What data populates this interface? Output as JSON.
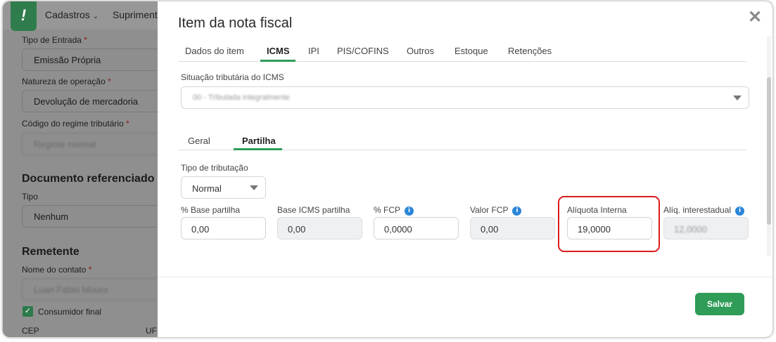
{
  "app": {
    "nav": [
      "Cadastros",
      "Suprimentos"
    ],
    "form": {
      "tipo_entrada_label": "Tipo de Entrada",
      "tipo_entrada_value": "Emissão Própria",
      "natureza_label": "Natureza de operação",
      "natureza_value": "Devolução de mercadoria",
      "regime_label": "Código do regime tributário",
      "regime_value": "Regime normal",
      "doc_ref_heading": "Documento referenciado",
      "tipo_label": "Tipo",
      "tipo_value": "Nenhum",
      "remetente_heading": "Remetente",
      "contato_label": "Nome do contato",
      "contato_value": "Luan Fábio Moura",
      "consumidor_label": "Consumidor final",
      "cep_label": "CEP",
      "uf_label": "UF",
      "required_mark": "*"
    }
  },
  "modal": {
    "title": "Item da nota fiscal",
    "close_glyph": "✕",
    "tabs": [
      "Dados do item",
      "ICMS",
      "IPI",
      "PIS/COFINS",
      "Outros",
      "Estoque",
      "Retenções"
    ],
    "active_tab": "ICMS",
    "situacao_label": "Situação tributária do ICMS",
    "situacao_value": "00 - Tributada integralmente",
    "subtabs": [
      "Geral",
      "Partilha"
    ],
    "active_subtab": "Partilha",
    "tipo_tributacao_label": "Tipo de tributação",
    "tipo_tributacao_value": "Normal",
    "fields": [
      {
        "label": "% Base partilha",
        "value": "0,00",
        "readonly": false,
        "info": false
      },
      {
        "label": "Base ICMS partilha",
        "value": "0,00",
        "readonly": true,
        "info": false
      },
      {
        "label": "% FCP",
        "value": "0,0000",
        "readonly": false,
        "info": true
      },
      {
        "label": "Valor FCP",
        "value": "0,00",
        "readonly": true,
        "info": true
      },
      {
        "label": "Alíquota Interna",
        "value": "19,0000",
        "readonly": false,
        "info": false
      },
      {
        "label": "Alíq. interestadual",
        "value": "12,0000",
        "readonly": true,
        "info": true
      }
    ],
    "info_glyph": "i",
    "save_label": "Salvar"
  },
  "colors": {
    "accent": "#2f9c57",
    "highlight": "#d91c1c",
    "info": "#2b86d8"
  }
}
